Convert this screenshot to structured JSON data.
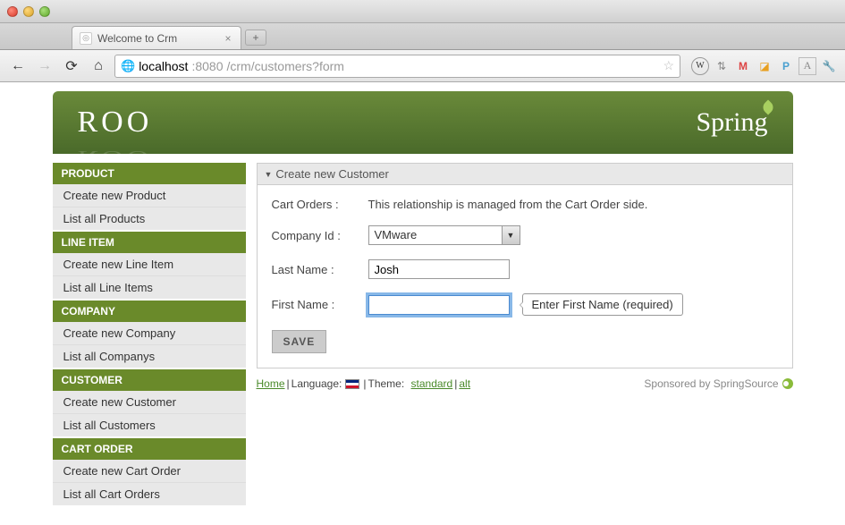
{
  "browser": {
    "tab_title": "Welcome to Crm",
    "url_host": "localhost",
    "url_port": ":8080",
    "url_path": "/crm/customers?form"
  },
  "header": {
    "logo_left": "ROO",
    "logo_right": "Spring"
  },
  "sidebar": [
    {
      "title": "PRODUCT",
      "items": [
        "Create new Product",
        "List all Products"
      ]
    },
    {
      "title": "LINE ITEM",
      "items": [
        "Create new Line Item",
        "List all Line Items"
      ]
    },
    {
      "title": "COMPANY",
      "items": [
        "Create new Company",
        "List all Companys"
      ]
    },
    {
      "title": "CUSTOMER",
      "items": [
        "Create new Customer",
        "List all Customers"
      ]
    },
    {
      "title": "CART ORDER",
      "items": [
        "Create new Cart Order",
        "List all Cart Orders"
      ]
    }
  ],
  "panel": {
    "title": "Create new Customer",
    "rows": {
      "cart_orders_label": "Cart Orders :",
      "cart_orders_value": "This relationship is managed from the Cart Order side.",
      "company_label": "Company Id :",
      "company_value": "VMware",
      "last_name_label": "Last Name :",
      "last_name_value": "Josh",
      "first_name_label": "First Name :",
      "first_name_value": "",
      "first_name_tooltip": "Enter First Name (required)"
    },
    "save_label": "SAVE"
  },
  "footer": {
    "home": "Home",
    "language_label": "Language:",
    "theme_label": "Theme:",
    "theme_standard": "standard",
    "theme_alt": "alt",
    "sponsor": "Sponsored by SpringSource"
  }
}
